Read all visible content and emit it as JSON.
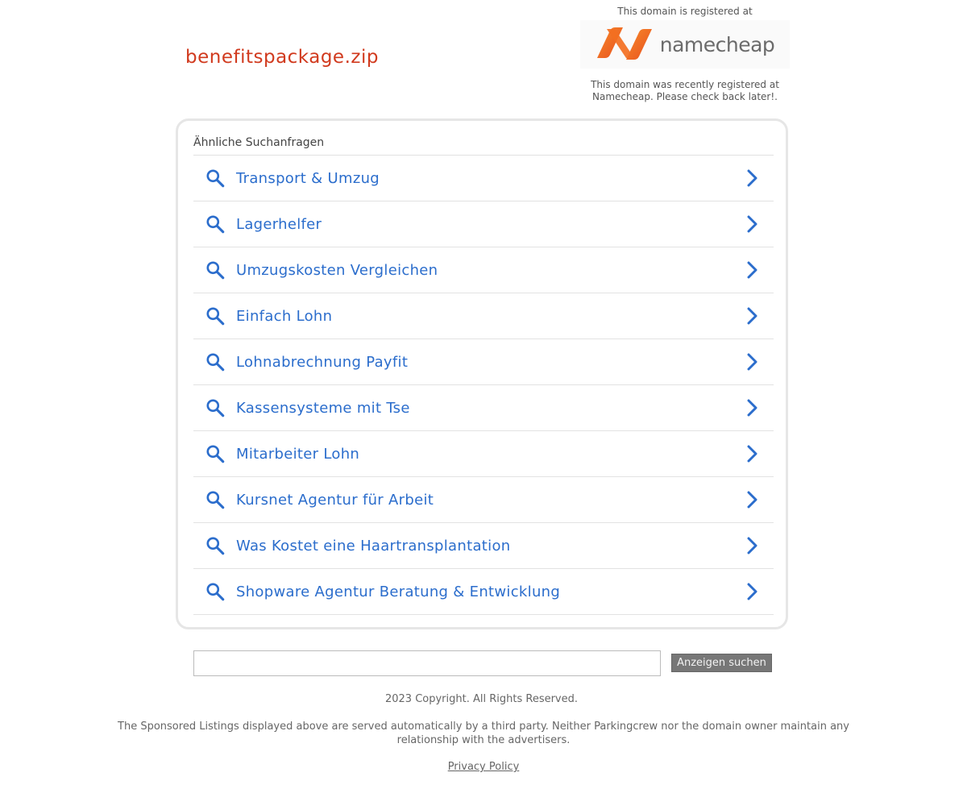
{
  "domain": "benefitspackage.zip",
  "registrar": {
    "top_line": "This domain is registered at",
    "logo_icon": "namecheap-logo-icon",
    "logo_text": "namecheap",
    "note": "This domain was recently registered at Namecheap. Please check back later!."
  },
  "related": {
    "heading": "Ähnliche Suchanfragen",
    "items": [
      {
        "label": "Transport & Umzug"
      },
      {
        "label": "Lagerhelfer"
      },
      {
        "label": "Umzugskosten Vergleichen"
      },
      {
        "label": "Einfach Lohn"
      },
      {
        "label": "Lohnabrechnung Payfit"
      },
      {
        "label": "Kassensysteme mit Tse"
      },
      {
        "label": "Mitarbeiter Lohn"
      },
      {
        "label": "Kursnet Agentur für Arbeit"
      },
      {
        "label": "Was Kostet eine Haartransplantation"
      },
      {
        "label": "Shopware Agentur Beratung & Entwicklung"
      }
    ]
  },
  "search": {
    "value": "",
    "button_label": "Anzeigen suchen"
  },
  "footer": {
    "copyright": "2023 Copyright. All Rights Reserved.",
    "disclaimer": "The Sponsored Listings displayed above are served automatically by a third party. Neither Parkingcrew nor the domain owner maintain any relationship with the advertisers.",
    "privacy_label": "Privacy Policy"
  },
  "colors": {
    "domain_title": "#d13a1e",
    "link_blue": "#2b6dcc",
    "namecheap_orange": "#f36f21"
  }
}
